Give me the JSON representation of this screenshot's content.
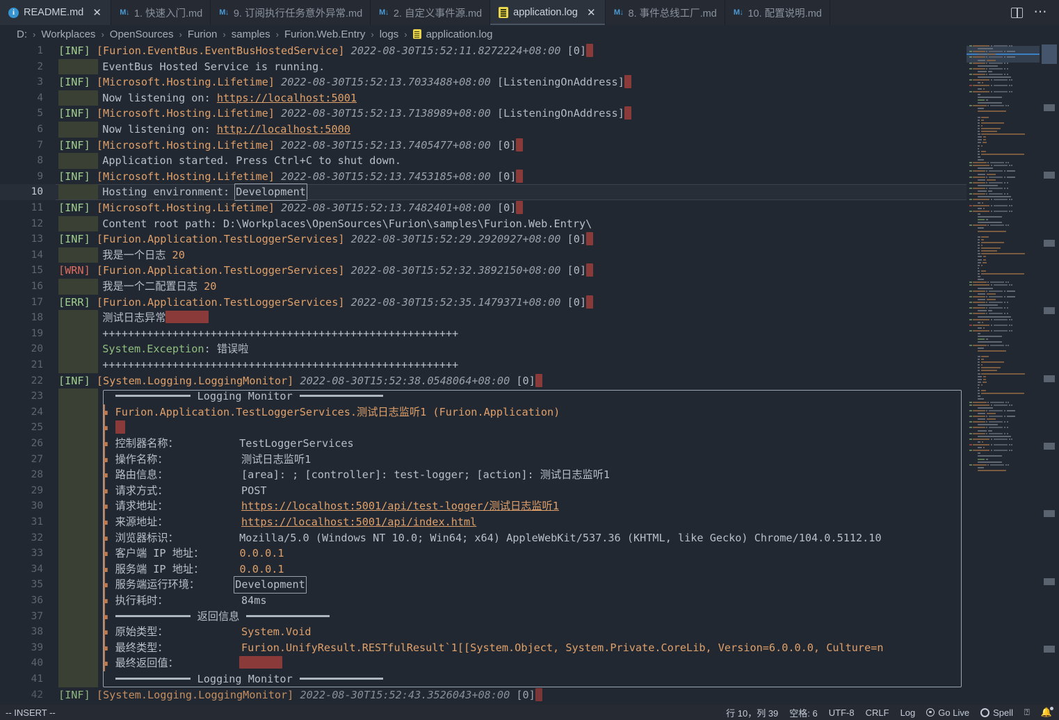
{
  "window": {
    "app": "Visual Studio Code",
    "active_file": "application.log"
  },
  "tabs": [
    {
      "label": "README.md",
      "icon": "info-icon",
      "state": "preview",
      "closable": true
    },
    {
      "label": "1. 快速入门.md",
      "icon": "markdown-icon",
      "state": "inactive",
      "closable": false
    },
    {
      "label": "9. 订阅执行任务意外异常.md",
      "icon": "markdown-icon",
      "state": "inactive",
      "closable": false
    },
    {
      "label": "2. 自定义事件源.md",
      "icon": "markdown-icon",
      "state": "inactive",
      "closable": false
    },
    {
      "label": "application.log",
      "icon": "log-file-icon",
      "state": "active",
      "closable": true
    },
    {
      "label": "8. 事件总线工厂.md",
      "icon": "markdown-icon",
      "state": "inactive",
      "closable": false
    },
    {
      "label": "10. 配置说明.md",
      "icon": "markdown-icon",
      "state": "inactive",
      "closable": false
    }
  ],
  "tabbar_actions": {
    "split_editor": "split-editor-icon",
    "more_actions": "more-actions-icon"
  },
  "breadcrumb": {
    "separator": "›",
    "items": [
      "D:",
      "Workplaces",
      "OpenSources",
      "Furion",
      "samples",
      "Furion.Web.Entry",
      "logs"
    ],
    "file": "application.log",
    "file_icon": "log-file-icon"
  },
  "editor": {
    "first_line": 1,
    "last_line": 42,
    "current_line": 10,
    "lines": [
      {
        "n": 1,
        "gutter": false,
        "spans": [
          [
            "inf",
            "[INF] "
          ],
          [
            "cat",
            "[Furion.EventBus.EventBusHostedService]"
          ],
          [
            "plain",
            " "
          ],
          [
            "time",
            "2022-08-30T15:52:11.8272224+08:00"
          ],
          [
            "plain",
            " "
          ],
          [
            "gray",
            "[0]"
          ],
          [
            "redbox-tiny",
            ""
          ]
        ]
      },
      {
        "n": 2,
        "gutter": true,
        "spans": [
          [
            "plain",
            "EventBus Hosted Service is running."
          ]
        ]
      },
      {
        "n": 3,
        "gutter": false,
        "spans": [
          [
            "inf",
            "[INF] "
          ],
          [
            "cat",
            "[Microsoft.Hosting.Lifetime]"
          ],
          [
            "plain",
            " "
          ],
          [
            "time",
            "2022-08-30T15:52:13.7033488+08:00"
          ],
          [
            "plain",
            " "
          ],
          [
            "gray",
            "[ListeningOnAddress]"
          ],
          [
            "redbox-tiny",
            ""
          ]
        ]
      },
      {
        "n": 4,
        "gutter": true,
        "spans": [
          [
            "plain",
            "Now listening on: "
          ],
          [
            "link",
            "https://localhost:5001"
          ]
        ]
      },
      {
        "n": 5,
        "gutter": false,
        "spans": [
          [
            "inf",
            "[INF] "
          ],
          [
            "cat",
            "[Microsoft.Hosting.Lifetime]"
          ],
          [
            "plain",
            " "
          ],
          [
            "time",
            "2022-08-30T15:52:13.7138989+08:00"
          ],
          [
            "plain",
            " "
          ],
          [
            "gray",
            "[ListeningOnAddress]"
          ],
          [
            "redbox-tiny",
            ""
          ]
        ]
      },
      {
        "n": 6,
        "gutter": true,
        "spans": [
          [
            "plain",
            "Now listening on: "
          ],
          [
            "link",
            "http://localhost:5000"
          ]
        ]
      },
      {
        "n": 7,
        "gutter": false,
        "spans": [
          [
            "inf",
            "[INF] "
          ],
          [
            "cat",
            "[Microsoft.Hosting.Lifetime]"
          ],
          [
            "plain",
            " "
          ],
          [
            "time",
            "2022-08-30T15:52:13.7405477+08:00"
          ],
          [
            "plain",
            " "
          ],
          [
            "gray",
            "[0]"
          ],
          [
            "redbox-tiny",
            ""
          ]
        ]
      },
      {
        "n": 8,
        "gutter": true,
        "spans": [
          [
            "plain",
            "Application started. Press Ctrl+C to shut down."
          ]
        ]
      },
      {
        "n": 9,
        "gutter": false,
        "spans": [
          [
            "inf",
            "[INF] "
          ],
          [
            "cat",
            "[Microsoft.Hosting.Lifetime]"
          ],
          [
            "plain",
            " "
          ],
          [
            "time",
            "2022-08-30T15:52:13.7453185+08:00"
          ],
          [
            "plain",
            " "
          ],
          [
            "gray",
            "[0]"
          ],
          [
            "redbox-tiny",
            ""
          ]
        ]
      },
      {
        "n": 10,
        "gutter": true,
        "current": true,
        "spans": [
          [
            "plain",
            "Hosting environment: "
          ],
          [
            "sel",
            "Development"
          ]
        ]
      },
      {
        "n": 11,
        "gutter": false,
        "spans": [
          [
            "inf",
            "[INF] "
          ],
          [
            "cat",
            "[Microsoft.Hosting.Lifetime]"
          ],
          [
            "plain",
            " "
          ],
          [
            "time",
            "2022-08-30T15:52:13.7482401+08:00"
          ],
          [
            "plain",
            " "
          ],
          [
            "gray",
            "[0]"
          ],
          [
            "redbox-tiny",
            ""
          ]
        ]
      },
      {
        "n": 12,
        "gutter": true,
        "spans": [
          [
            "plain",
            "Content root path: D:\\Workplaces\\OpenSources\\Furion\\samples\\Furion.Web.Entry\\"
          ]
        ]
      },
      {
        "n": 13,
        "gutter": false,
        "spans": [
          [
            "inf",
            "[INF] "
          ],
          [
            "cat",
            "[Furion.Application.TestLoggerServices]"
          ],
          [
            "plain",
            " "
          ],
          [
            "time",
            "2022-08-30T15:52:29.2920927+08:00"
          ],
          [
            "plain",
            " "
          ],
          [
            "gray",
            "[0]"
          ],
          [
            "redbox-tiny",
            ""
          ]
        ]
      },
      {
        "n": 14,
        "gutter": true,
        "spans": [
          [
            "plain",
            "我是一个日志 "
          ],
          [
            "num",
            "20"
          ]
        ]
      },
      {
        "n": 15,
        "gutter": false,
        "spans": [
          [
            "wrn",
            "[WRN] "
          ],
          [
            "cat",
            "[Furion.Application.TestLoggerServices]"
          ],
          [
            "plain",
            " "
          ],
          [
            "time",
            "2022-08-30T15:52:32.3892150+08:00"
          ],
          [
            "plain",
            " "
          ],
          [
            "gray",
            "[0]"
          ],
          [
            "redbox-tiny",
            ""
          ]
        ]
      },
      {
        "n": 16,
        "gutter": true,
        "spans": [
          [
            "plain",
            "我是一个二配置日志 "
          ],
          [
            "num",
            "20"
          ]
        ]
      },
      {
        "n": 17,
        "gutter": false,
        "spans": [
          [
            "inf",
            "[ERR] "
          ],
          [
            "cat",
            "[Furion.Application.TestLoggerServices]"
          ],
          [
            "plain",
            " "
          ],
          [
            "time",
            "2022-08-30T15:52:35.1479371+08:00"
          ],
          [
            "plain",
            " "
          ],
          [
            "gray",
            "[0]"
          ],
          [
            "redbox-tiny",
            ""
          ]
        ]
      },
      {
        "n": 18,
        "gutter": true,
        "spans": [
          [
            "plain",
            "测试日志异常"
          ],
          [
            "redbox",
            ""
          ]
        ]
      },
      {
        "n": 19,
        "gutter": true,
        "spans": [
          [
            "plain",
            "++++++++++++++++++++++++++++++++++++++++++++++++++++++++"
          ]
        ]
      },
      {
        "n": 20,
        "gutter": true,
        "spans": [
          [
            "green",
            "System.Exception"
          ],
          [
            "plain",
            ": 错误啦"
          ]
        ]
      },
      {
        "n": 21,
        "gutter": true,
        "spans": [
          [
            "plain",
            "++++++++++++++++++++++++++++++++++++++++++++++++++++++++"
          ]
        ]
      },
      {
        "n": 22,
        "gutter": false,
        "spans": [
          [
            "inf",
            "[INF] "
          ],
          [
            "cat",
            "[System.Logging.LoggingMonitor]"
          ],
          [
            "plain",
            " "
          ],
          [
            "time",
            "2022-08-30T15:52:38.0548064+08:00"
          ],
          [
            "plain",
            " "
          ],
          [
            "gray",
            "[0]"
          ],
          [
            "redbox-tiny",
            ""
          ]
        ]
      },
      {
        "n": 23,
        "gutter": true,
        "rule_title": "Logging Monitor"
      },
      {
        "n": 24,
        "gutter": true,
        "bullet": true,
        "spans": [
          [
            "cat",
            "Furion.Application.TestLoggerServices.测试日志监听1 (Furion.Application)"
          ]
        ]
      },
      {
        "n": 25,
        "gutter": true,
        "bullet": true,
        "spans": [
          [
            "redbox-sm",
            ""
          ]
        ]
      },
      {
        "n": 26,
        "gutter": true,
        "bullet": true,
        "label": "控制器名称：",
        "value": "TestLoggerServices",
        "vclass": "plain"
      },
      {
        "n": 27,
        "gutter": true,
        "bullet": true,
        "label": "操作名称：",
        "value": "测试日志监听1",
        "vclass": "plain"
      },
      {
        "n": 28,
        "gutter": true,
        "bullet": true,
        "label": "路由信息：",
        "value": "[area]: ; [controller]: test-logger; [action]: 测试日志监听1",
        "vclass": "plain"
      },
      {
        "n": 29,
        "gutter": true,
        "bullet": true,
        "label": "请求方式：",
        "value": "POST",
        "vclass": "plain"
      },
      {
        "n": 30,
        "gutter": true,
        "bullet": true,
        "label": "请求地址：",
        "value": "https://localhost:5001/api/test-logger/测试日志监听1",
        "vclass": "link"
      },
      {
        "n": 31,
        "gutter": true,
        "bullet": true,
        "label": "来源地址：",
        "value": "https://localhost:5001/api/index.html",
        "vclass": "link"
      },
      {
        "n": 32,
        "gutter": true,
        "bullet": true,
        "label": "浏览器标识：",
        "value": "Mozilla/5.0 (Windows NT 10.0; Win64; x64) AppleWebKit/537.36 (KHTML, like Gecko) Chrome/104.0.5112.10",
        "vclass": "ua"
      },
      {
        "n": 33,
        "gutter": true,
        "bullet": true,
        "label": "客户端 IP 地址：",
        "value": "0.0.0.1",
        "vclass": "num"
      },
      {
        "n": 34,
        "gutter": true,
        "bullet": true,
        "label": "服务端 IP 地址：",
        "value": "0.0.0.1",
        "vclass": "num"
      },
      {
        "n": 35,
        "gutter": true,
        "bullet": true,
        "label": "服务端运行环境：",
        "value": "Development",
        "vclass": "sel"
      },
      {
        "n": 36,
        "gutter": true,
        "bullet": true,
        "label": "执行耗时：",
        "value": "84ms",
        "vclass": "plain"
      },
      {
        "n": 37,
        "gutter": true,
        "bullet": true,
        "rule_title": "返回信息"
      },
      {
        "n": 38,
        "gutter": true,
        "bullet": true,
        "label": "原始类型：",
        "value": "System.Void",
        "vclass": "cat"
      },
      {
        "n": 39,
        "gutter": true,
        "bullet": true,
        "label": "最终类型：",
        "value": "Furion.UnifyResult.RESTfulResult`1[[System.Object, System.Private.CoreLib, Version=6.0.0.0, Culture=n",
        "vclass": "cat"
      },
      {
        "n": 40,
        "gutter": true,
        "bullet": true,
        "label": "最终返回值：",
        "value": "",
        "vclass": "redbox"
      },
      {
        "n": 41,
        "gutter": true,
        "rule_title": "Logging Monitor"
      },
      {
        "n": 42,
        "gutter": false,
        "clipped": true,
        "spans": [
          [
            "inf",
            "[INF] "
          ],
          [
            "cat",
            "[System.Logging.LoggingMonitor]"
          ],
          [
            "plain",
            " "
          ],
          [
            "time",
            "2022-08-30T15:52:43.3526043+08:00"
          ],
          [
            "plain",
            " "
          ],
          [
            "gray",
            "[0]"
          ],
          [
            "redbox-tiny",
            ""
          ]
        ]
      }
    ]
  },
  "minimap": {
    "name": "minimap",
    "slider_visible": true
  },
  "statusbar": {
    "mode": "-- INSERT --",
    "cursor": "行 10，列 39",
    "indent": "空格: 6",
    "encoding": "UTF-8",
    "eol": "CRLF",
    "language": "Log",
    "golive": "Go Live",
    "spell": "Spell",
    "feedback_icon": "feedback-icon",
    "bell_icon": "bell-icon"
  },
  "colors": {
    "editor_bg": "#222831",
    "tabbar_bg": "#252a33",
    "active_tab_bg": "#2d333d",
    "info_level": "#9fcf8e",
    "warn_level": "#e06c5d",
    "category": "#e0a06a",
    "timestamp": "#98a0aa",
    "link": "#e0a06a",
    "plain_text": "#b8bfc9",
    "gutter_block": "#3a4034",
    "redacted": "#8b3a3a",
    "bullet_line": "#c07a50",
    "line_number": "#5d6672"
  }
}
